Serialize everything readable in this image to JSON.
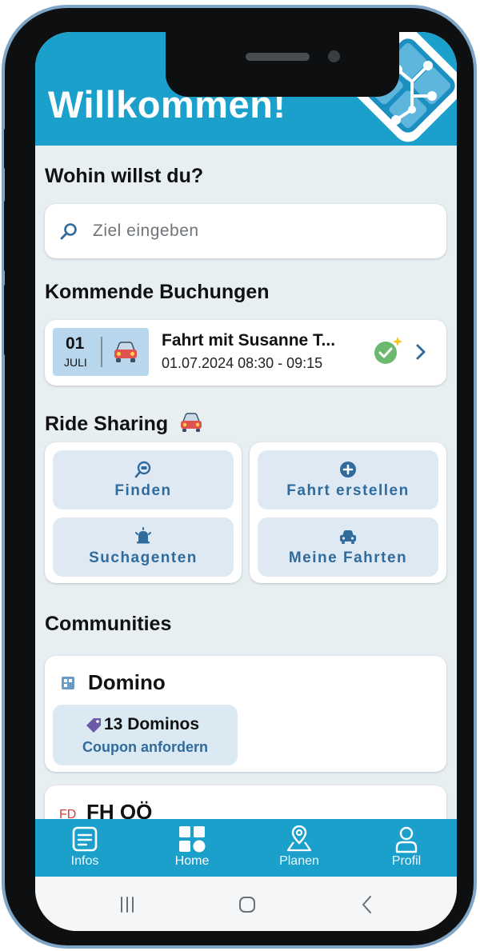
{
  "header": {
    "title": "Willkommen!"
  },
  "search": {
    "heading": "Wohin willst du?",
    "placeholder": "Ziel eingeben",
    "icon": "search-icon"
  },
  "bookings": {
    "heading": "Kommende Buchungen",
    "items": [
      {
        "day": "01",
        "month": "JULI",
        "title": "Fahrt mit Susanne T...",
        "time": "01.07.2024 08:30 - 09:15",
        "status": "confirmed"
      }
    ]
  },
  "ride_sharing": {
    "heading": "Ride Sharing",
    "actions": [
      {
        "label": "Finden",
        "icon": "search-car-icon"
      },
      {
        "label": "Fahrt erstellen",
        "icon": "plus-circle-icon"
      },
      {
        "label": "Suchagenten",
        "icon": "alarm-bell-icon"
      },
      {
        "label": "Meine Fahrten",
        "icon": "car-icon"
      }
    ]
  },
  "communities": {
    "heading": "Communities",
    "items": [
      {
        "name": "Domino",
        "count_text": "13 Dominos",
        "link": "Coupon anfordern"
      },
      {
        "name": "FH OÖ",
        "logo_text": "FD"
      }
    ]
  },
  "nav": {
    "items": [
      {
        "label": "Infos",
        "icon": "news-icon"
      },
      {
        "label": "Home",
        "icon": "home-grid-icon"
      },
      {
        "label": "Planen",
        "icon": "map-pin-icon"
      },
      {
        "label": "Profil",
        "icon": "person-icon"
      }
    ]
  },
  "colors": {
    "primary": "#1ba0cb",
    "accent_text": "#2f6b9c",
    "tile_bg": "#dfe9f3",
    "background": "#e8eff3"
  }
}
